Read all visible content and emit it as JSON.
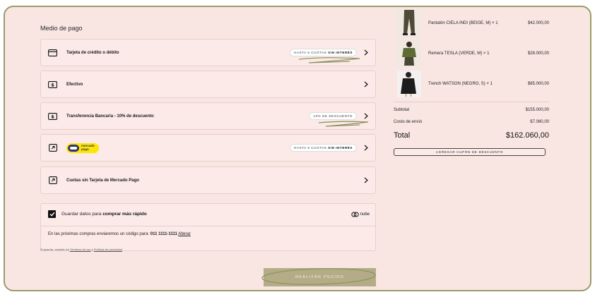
{
  "payment": {
    "title": "Medio de pago",
    "options": [
      {
        "label": "Tarjeta de crédito o débito",
        "badge_pre": "HASTA 6 CUOTAS ",
        "badge_bold": "SIN INTERÉS"
      },
      {
        "label": "Efectivo"
      },
      {
        "label": "Transferencia Bancaria - 10% de descuento",
        "badge_pre": "10% DE DESCUENTO",
        "badge_bold": ""
      },
      {
        "logo_line1": "mercado",
        "logo_line2": "pago",
        "badge_pre": "HASTA 6 CUOTAS ",
        "badge_bold": "SIN INTERÉS"
      },
      {
        "label": "Cuotas sin Tarjeta de Mercado Pago"
      }
    ]
  },
  "save_data": {
    "label_pre": "Guardar datos para ",
    "label_bold": "comprar más rápido",
    "brand": "nube",
    "code_pre": "En las próximas compras enviaremos un código para: ",
    "phone": "011 1111-1111",
    "change_link": "Alterar"
  },
  "legal": {
    "pre": "Al guardar, aceptás los ",
    "terms": "Términos de uso",
    "mid": " y ",
    "privacy": "Políticas de privacidad"
  },
  "submit_label": "REALIZAR PEDIDO",
  "cart": {
    "items": [
      {
        "name": "Pantalón CIELA INDI (BEIGE, M) × 1",
        "price": "$42.000,00"
      },
      {
        "name": "Remera TESLA (VERDE, M) × 1",
        "price": "$28.000,00"
      },
      {
        "name": "Trench WATSON (NEGRO, S) × 1",
        "price": "$85.000,00"
      }
    ],
    "subtotal_label": "Subtotal",
    "subtotal": "$155.000,00",
    "shipping_label": "Costo de envío",
    "shipping": "$7.060,00",
    "total_label": "Total",
    "total": "$162.060,00",
    "coupon_label": "AGREGAR CUPÓN DE DESCUENTO"
  },
  "colors": {
    "background": "#f9e6e3",
    "frame_border": "#9a9b6a",
    "submit_button": "#b3ac86",
    "mercado_pago_yellow": "#ffe600",
    "mercado_pago_blue": "#2d3277"
  }
}
